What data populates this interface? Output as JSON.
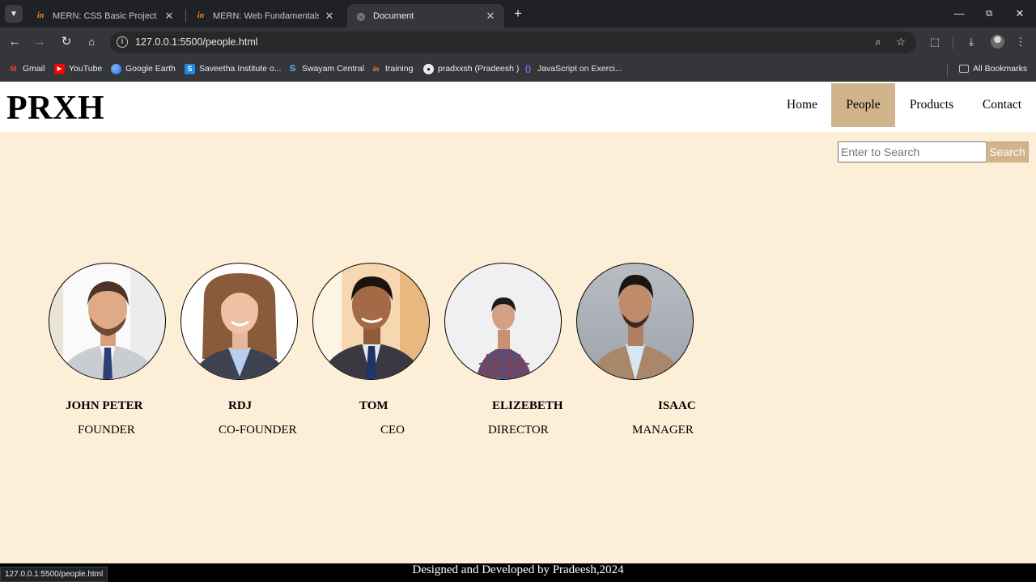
{
  "browser": {
    "tabs": [
      {
        "title": "MERN: CSS Basic Project | SEC",
        "favicon": "interviewbit-icon",
        "active": false
      },
      {
        "title": "MERN: Web Fundamentals and",
        "favicon": "interviewbit-icon",
        "active": false
      },
      {
        "title": "Document",
        "favicon": "globe-icon",
        "active": true
      }
    ],
    "url": "127.0.0.1:5500/people.html",
    "bookmarks": [
      {
        "label": "Gmail",
        "icon": "gmail-icon"
      },
      {
        "label": "YouTube",
        "icon": "youtube-icon"
      },
      {
        "label": "Google Earth",
        "icon": "google-earth-icon"
      },
      {
        "label": "Saveetha Institute o...",
        "icon": "saveetha-icon"
      },
      {
        "label": "Swayam Central",
        "icon": "swayam-icon"
      },
      {
        "label": "training",
        "icon": "interviewbit-icon"
      },
      {
        "label": "pradxxsh (Pradeesh )",
        "icon": "github-icon"
      },
      {
        "label": "JavaScript on Exerci...",
        "icon": "exercism-icon"
      }
    ],
    "all_bookmarks": "All Bookmarks",
    "status_url": "127.0.0.1:5500/people.html"
  },
  "site": {
    "logo": "PRXH",
    "nav": [
      {
        "label": "Home",
        "active": false
      },
      {
        "label": "People",
        "active": true
      },
      {
        "label": "Products",
        "active": false
      },
      {
        "label": "Contact",
        "active": false
      }
    ],
    "search": {
      "placeholder": "Enter to Search",
      "button": "Search"
    },
    "people": [
      {
        "name": "JOHN PETER",
        "role": "FOUNDER"
      },
      {
        "name": "RDJ",
        "role": "CO-FOUNDER"
      },
      {
        "name": "TOM",
        "role": "CEO"
      },
      {
        "name": "ELIZEBETH",
        "role": "DIRECTOR"
      },
      {
        "name": "ISAAC",
        "role": "MANAGER"
      }
    ],
    "footer": "Designed and Developed by Pradeesh,2024"
  },
  "colors": {
    "page_background": "#fdefd7",
    "nav_active": "#d2b48c",
    "header_background": "#ffffff",
    "footer_background": "#000000"
  }
}
